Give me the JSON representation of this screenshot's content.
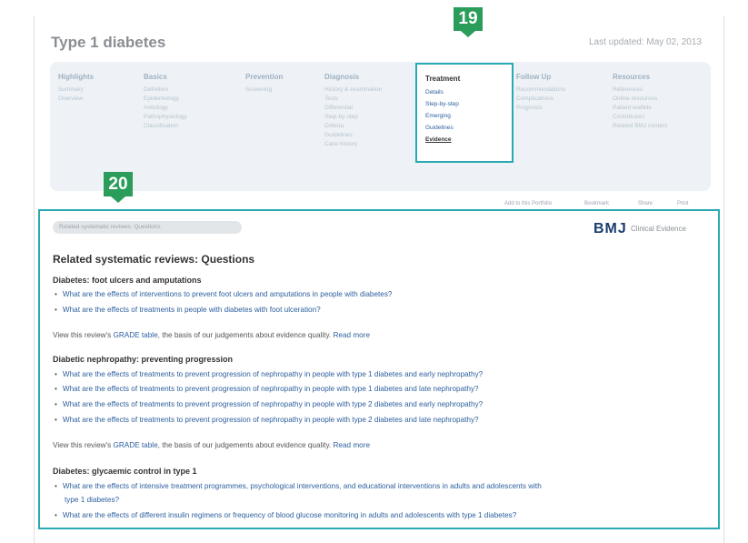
{
  "page": {
    "title": "Type 1 diabetes",
    "last_updated": "Last updated: May 02, 2013"
  },
  "nav": {
    "highlights": {
      "head": "Highlights",
      "items": [
        "Summary",
        "Overview"
      ]
    },
    "basics": {
      "head": "Basics",
      "items": [
        "Definition",
        "Epidemiology",
        "Aetiology",
        "Pathophysiology",
        "Classification"
      ]
    },
    "prevention": {
      "head": "Prevention",
      "items": [
        "Screening"
      ]
    },
    "diagnosis": {
      "head": "Diagnosis",
      "items": [
        "History & examination",
        "Tests",
        "Differential",
        "Step-by-step",
        "Criteria",
        "Guidelines",
        "Case history"
      ]
    },
    "treatment": {
      "head": "Treatment",
      "items": [
        "Details",
        "Step-by-step",
        "Emerging",
        "Guidelines",
        "Evidence"
      ]
    },
    "follow_up": {
      "head": "Follow Up",
      "items": [
        "Recommendations",
        "Complications",
        "Prognosis"
      ]
    },
    "resources": {
      "head": "Resources",
      "items": [
        "References",
        "Online resources",
        "Patient leaflets",
        "Contributors",
        "Related BMJ content"
      ]
    }
  },
  "badges": {
    "b19": "19",
    "b20": "20"
  },
  "toolbar": {
    "add_to_portfolio": "Add to this Portfolio",
    "bookmark": "Bookmark",
    "share": "Share",
    "print": "Print"
  },
  "content": {
    "pill": "Related systematic reviews: Questions",
    "bmj_logo": "BMJ",
    "bmj_sub": "Clinical Evidence",
    "heading": "Related systematic reviews: Questions",
    "sections": [
      {
        "title": "Diabetes: foot ulcers and amputations",
        "questions": [
          "What are the effects of interventions to prevent foot ulcers and amputations in people with diabetes?",
          "What are the effects of treatments in people with diabetes with foot ulceration?"
        ]
      },
      {
        "title": "Diabetic nephropathy: preventing progression",
        "questions": [
          "What are the effects of treatments to prevent progression of nephropathy in people with type 1 diabetes and early nephropathy?",
          "What are the effects of treatments to prevent progression of nephropathy in people with type 1 diabetes and late nephropathy?",
          "What are the effects of treatments to prevent progression of nephropathy in people with type 2 diabetes and early nephropathy?",
          "What are the effects of treatments to prevent progression of nephropathy in people with type 2 diabetes and late nephropathy?"
        ]
      },
      {
        "title": "Diabetes: glycaemic control in type 1",
        "questions": [
          "What are the effects of intensive treatment programmes, psychological interventions, and educational interventions in adults and adolescents with",
          "type 1 diabetes?",
          "What are the effects of different insulin regimens or frequency of blood glucose monitoring in adults and adolescents with type 1 diabetes?"
        ]
      }
    ],
    "view_text_1": "View this review's",
    "grade_link": "GRADE table",
    "view_text_2": ", the basis of our judgements about evidence quality.",
    "read_more": "Read more"
  },
  "colors": {
    "accent": "#29aab2",
    "badge": "#2a9d5b",
    "link": "#2c5f9e",
    "brand": "#1a3c6e"
  }
}
